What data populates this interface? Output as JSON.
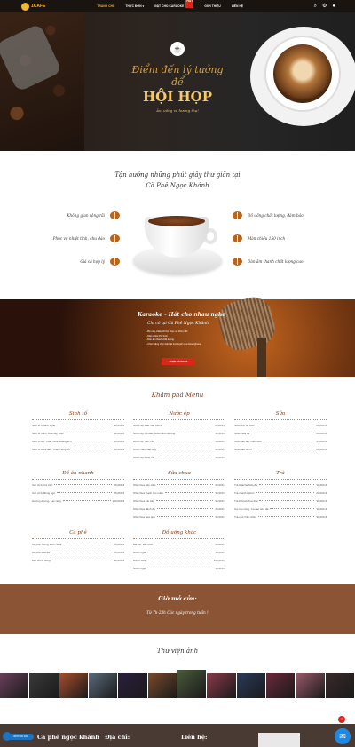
{
  "nav": {
    "logo": "1CAFE",
    "items": [
      "TRANG CHỦ",
      "THỰC ĐƠN ▾",
      "ĐẶT CHỖ KARAOKE",
      "GIỚI THIỆU",
      "LIÊN HỆ"
    ],
    "badge": "HOT",
    "icons": [
      "search-icon",
      "gear-icon",
      "user-icon"
    ]
  },
  "hero": {
    "line1": "Điểm đến lý tưởng",
    "line2": "để",
    "line3": "HỘI HỌP",
    "sub": "Ăn, uống và hưởng thụ!"
  },
  "about": {
    "title": "Tận hưởng những phút giây thư giãn tại",
    "subtitle": "Cà Phê Ngọc Khánh",
    "left": [
      "Không gian rộng rãi",
      "Phục vụ nhiệt tình, chu đáo",
      "Giá cả hợp lý"
    ],
    "right": [
      "Đồ uống chất lượng, đảm bảo",
      "Màn chiếu 150 inch",
      "Dàn âm thanh chất lượng cao"
    ]
  },
  "karaoke": {
    "title": "Karaoke - Hát cho nhau nghe",
    "subtitle": "Chỉ có tại Cà Phê Ngọc Khánh",
    "list": [
      "Bộ máy chiếu cỡ lớn phục vụ FULL HD",
      "Màn chiếu 150 inch",
      "Dàn âm thanh chất lượng",
      "Chức năng chọn bài hát trực tuyến qua Smartphone"
    ],
    "button": "CHỌN BÀI NGAY"
  },
  "menu": {
    "title": "Khám phá Menu",
    "categories": [
      {
        "name": "Sinh tố",
        "items": [
          {
            "n": "Sinh tố Chanh tuyết",
            "p": "30,000 đ"
          },
          {
            "n": "Sinh tố Cam, Dâu tây, Kiwi",
            "p": "30,000 đ"
          },
          {
            "n": "Sinh tố Bơ, Xoài, Dưa Hoàng kim",
            "p": "30,000 đ"
          },
          {
            "n": "Sinh tố Dưa hấu, Thanh long đỏ",
            "p": "30,000 đ"
          }
        ]
      },
      {
        "name": "Nước ép",
        "items": [
          {
            "n": "Nước ép Rau má, Cà rốt",
            "p": "25,000 đ"
          },
          {
            "n": "Nước ép Củ dâu, Dưa hấu mật ong",
            "p": "30,000 đ"
          },
          {
            "n": "Nước ép Táo, Lê",
            "p": "30,000 đ"
          },
          {
            "n": "Nước cam mật ong",
            "p": "30,000 đ"
          },
          {
            "n": "Nước ép Dừa, Ổi",
            "p": "30,000 đ"
          }
        ]
      },
      {
        "name": "Sữa chua",
        "items": [
          {
            "n": "Sữa chua nếp cẩm",
            "p": "30,000 đ"
          },
          {
            "n": "Sữa chua thạch lựu mâm",
            "p": "35,000 đ"
          },
          {
            "n": "Sữa chua trái cây",
            "p": "35,000 đ"
          },
          {
            "n": "Sữa chua đánh đá",
            "p": "25,000 đ"
          },
          {
            "n": "Sữa chua hoa quả",
            "p": "35,000 đ"
          }
        ]
      },
      {
        "name": "Đồ uống khác",
        "items": [
          {
            "n": "Bia lon, Bia chai",
            "p": "30,000 đ"
          },
          {
            "n": "Nước ngọt",
            "p": "15,000 đ"
          },
          {
            "n": "Rượu vang",
            "p": "350,000 đ"
          },
          {
            "n": "Nước ngọt",
            "p": "15,000 đ"
          }
        ]
      },
      {
        "name": "Sữa",
        "items": [
          {
            "n": "Sữa tươi bò tươi",
            "p": "20,000 đ"
          },
          {
            "n": "Sữa chua đá",
            "p": "20,000 đ"
          },
          {
            "n": "Sữa Dâu tây, Cam tươi",
            "p": "25,000 đ"
          },
          {
            "n": "Sữa Đậu nành",
            "p": "20,000 đ"
          }
        ]
      },
      {
        "name": "Đồ ăn nhanh",
        "items": [
          {
            "n": "Xúc xích, Cá viên",
            "p": "25,000 đ"
          },
          {
            "n": "Xúc xích, Bông ngô",
            "p": "25,000 đ"
          },
          {
            "n": "Hướng dương, Lạc rang",
            "p": "100,000 đ"
          }
        ]
      },
      {
        "name": "Trà",
        "items": [
          {
            "n": "Trà Matcha Sữa đá",
            "p": "30,000 đ"
          },
          {
            "n": "Trà chanh Lipton",
            "p": "20,000 đ"
          },
          {
            "n": "Trà Dilmah Xoa thái",
            "p": "30,000 đ"
          },
          {
            "n": "Ca cao nóng, Ca cao sữa đá",
            "p": "30,000 đ"
          },
          {
            "n": "Trà sữa Trân châu",
            "p": "30,000 đ"
          }
        ]
      },
      {
        "name": "Cà phê",
        "items": [
          {
            "n": "Cà phê Trứng, Đen, Sữa",
            "p": "25,000 đ"
          },
          {
            "n": "Cà phê sữa đá",
            "p": "25,000 đ"
          },
          {
            "n": "Bạc xỉu bí bông",
            "p": "30,000 đ"
          }
        ]
      }
    ]
  },
  "hours": {
    "title": "Giờ mở cửa:",
    "text": "Từ 7h-23h Các ngày trong tuần !"
  },
  "gallery": {
    "title": "Thư viện ảnh",
    "colors": [
      "#6a3f5a",
      "#3a3a3a",
      "#a64d2b",
      "#5a6a7a",
      "#2a1f3f",
      "#7a4a2a",
      "#4a5a3a",
      "#8a3a4a",
      "#2a3a5a",
      "#6a2a3a",
      "#9a5a6a",
      "#3a2a2a"
    ]
  },
  "footer": {
    "brand": "Cà phê ngọc khánh",
    "address": "Địa chỉ:",
    "contact": "Liên hệ:",
    "phone": "0978 000 345"
  },
  "widgets": {
    "scroll_top": "↑",
    "messenger": "✉"
  }
}
